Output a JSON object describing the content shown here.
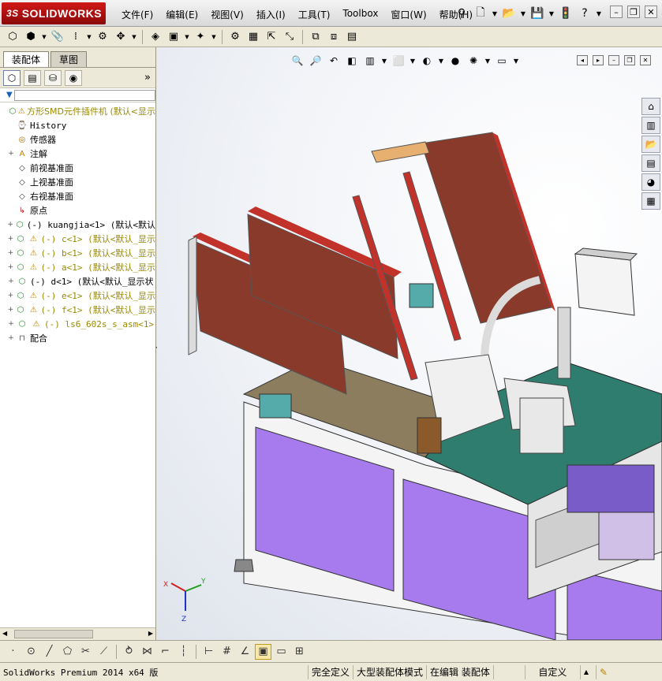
{
  "app": {
    "logo_ds": "3S",
    "logo_text": "SOLIDWORKS"
  },
  "menu": [
    "文件(F)",
    "编辑(E)",
    "视图(V)",
    "插入(I)",
    "工具(T)",
    "Toolbox",
    "窗口(W)",
    "帮助(H)"
  ],
  "quick_access": [
    {
      "name": "pin-icon",
      "glyph": "⚲"
    },
    {
      "name": "new-document-icon",
      "glyph": "🗋"
    },
    {
      "name": "open-folder-icon",
      "glyph": "📂"
    },
    {
      "name": "save-icon",
      "glyph": "💾"
    },
    {
      "name": "traffic-light-icon",
      "glyph": "🚦"
    },
    {
      "name": "help-icon",
      "glyph": "?"
    }
  ],
  "window_controls": {
    "minimize": "–",
    "restore": "❐",
    "close": "✕"
  },
  "panel_tabs": {
    "assembly": "装配体",
    "sketch": "草图"
  },
  "panel_more": "»",
  "filter_icon": "▼",
  "tree": [
    {
      "icon": "assembly",
      "warn": true,
      "expand": "",
      "label": "方形SMD元件插件机  (默认<显示",
      "style": "yellow plain",
      "indent": 0
    },
    {
      "icon": "history",
      "warn": false,
      "expand": "",
      "label": "History",
      "style": "normal",
      "indent": 1
    },
    {
      "icon": "sensor",
      "warn": false,
      "expand": "",
      "label": "传感器",
      "style": "normal plain",
      "indent": 1
    },
    {
      "icon": "annotation",
      "warn": false,
      "expand": "+",
      "label": "注解",
      "style": "normal plain",
      "indent": 1
    },
    {
      "icon": "plane",
      "warn": false,
      "expand": "",
      "label": "前视基准面",
      "style": "normal plain",
      "indent": 1
    },
    {
      "icon": "plane",
      "warn": false,
      "expand": "",
      "label": "上视基准面",
      "style": "normal plain",
      "indent": 1
    },
    {
      "icon": "plane",
      "warn": false,
      "expand": "",
      "label": "右视基准面",
      "style": "normal plain",
      "indent": 1
    },
    {
      "icon": "origin",
      "warn": false,
      "expand": "",
      "label": "原点",
      "style": "normal plain",
      "indent": 1
    },
    {
      "icon": "component",
      "warn": false,
      "expand": "+",
      "label": "(-) kuangjia<1> (默认<默认",
      "style": "normal",
      "indent": 1
    },
    {
      "icon": "component",
      "warn": true,
      "expand": "+",
      "label": "(-) c<1> (默认<默认_显示",
      "style": "yellow",
      "indent": 1
    },
    {
      "icon": "component",
      "warn": true,
      "expand": "+",
      "label": "(-) b<1> (默认<默认_显示",
      "style": "yellow",
      "indent": 1
    },
    {
      "icon": "component",
      "warn": true,
      "expand": "+",
      "label": "(-) a<1> (默认<默认_显示",
      "style": "yellow",
      "indent": 1
    },
    {
      "icon": "component",
      "warn": false,
      "expand": "+",
      "label": "(-) d<1> (默认<默认_显示状",
      "style": "normal",
      "indent": 1
    },
    {
      "icon": "component",
      "warn": true,
      "expand": "+",
      "label": "(-) e<1> (默认<默认_显示",
      "style": "yellow",
      "indent": 1
    },
    {
      "icon": "component",
      "warn": true,
      "expand": "+",
      "label": "(-) f<1> (默认<默认_显示",
      "style": "yellow",
      "indent": 1
    },
    {
      "icon": "component",
      "warn": true,
      "expand": "+",
      "label": "(-) ls6_602s_s_asm<1>",
      "style": "yellow",
      "indent": 1
    },
    {
      "icon": "mates",
      "warn": false,
      "expand": "+",
      "label": "配合",
      "style": "normal plain",
      "indent": 1
    }
  ],
  "triad": {
    "x": "X",
    "y": "Y",
    "z": "Z"
  },
  "status": {
    "product": "SolidWorks Premium 2014 x64 版",
    "definition": "完全定义",
    "mode": "大型装配体模式",
    "editing": "在编辑 装配体",
    "units": "自定义",
    "units_arrow": "▲"
  },
  "colors": {
    "logo_red": "#c41212",
    "plate_purple": "#a77bee",
    "tabletop_teal": "#2e7d6e",
    "tray_red": "#c1322a",
    "warning_yellow": "#d6a400"
  }
}
